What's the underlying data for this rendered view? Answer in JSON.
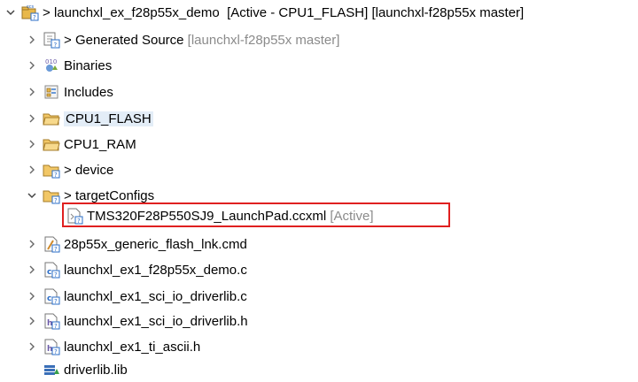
{
  "project": {
    "prefix": "> ",
    "name": "launchxl_ex_f28p55x_demo",
    "decoration": "  [Active - CPU1_FLASH] [launchxl-f28p55x master]",
    "icon": "ccs-project-icon"
  },
  "items": [
    {
      "prefix": "> ",
      "label": "Generated Source",
      "decoration": " [launchxl-f28p55x master]",
      "icon": "generated-folder-icon"
    },
    {
      "prefix": "",
      "label": "Binaries",
      "decoration": "",
      "icon": "binaries-icon"
    },
    {
      "prefix": "",
      "label": "Includes",
      "decoration": "",
      "icon": "includes-icon"
    },
    {
      "prefix": "",
      "label": "CPU1_FLASH",
      "decoration": "",
      "icon": "folder-icon"
    },
    {
      "prefix": "",
      "label": "CPU1_RAM",
      "decoration": "",
      "icon": "folder-icon"
    },
    {
      "prefix": "> ",
      "label": "device",
      "decoration": "",
      "icon": "linked-folder-icon"
    },
    {
      "prefix": "> ",
      "label": "targetConfigs",
      "decoration": "",
      "icon": "linked-folder-icon"
    },
    {
      "prefix": "",
      "label": "TMS320F28P550SJ9_LaunchPad.ccxml",
      "decoration": " [Active]",
      "icon": "ccxml-file-icon"
    },
    {
      "prefix": "",
      "label": "28p55x_generic_flash_lnk.cmd",
      "decoration": "",
      "icon": "cmd-file-icon"
    },
    {
      "prefix": "",
      "label": "launchxl_ex1_f28p55x_demo.c",
      "decoration": "",
      "icon": "c-file-icon"
    },
    {
      "prefix": "",
      "label": "launchxl_ex1_sci_io_driverlib.c",
      "decoration": "",
      "icon": "c-file-icon"
    },
    {
      "prefix": "",
      "label": "launchxl_ex1_sci_io_driverlib.h",
      "decoration": "",
      "icon": "h-file-icon"
    },
    {
      "prefix": "",
      "label": "launchxl_ex1_ti_ascii.h",
      "decoration": "",
      "icon": "h-file-icon"
    },
    {
      "prefix": "",
      "label": "driverlib.lib",
      "decoration": "",
      "icon": "lib-file-icon"
    }
  ],
  "colors": {
    "decoration": "#8b8b8b",
    "highlight_border": "#e02020",
    "folder": "#e8b84a",
    "selection": "#e3edf7"
  }
}
